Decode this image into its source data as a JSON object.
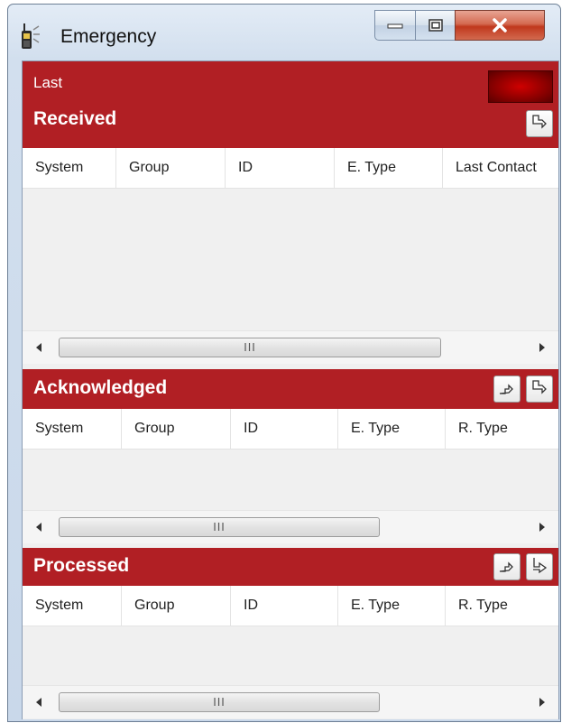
{
  "window": {
    "title": "Emergency"
  },
  "received": {
    "label_small": "Last",
    "label": "Received",
    "columns": [
      "System",
      "Group",
      "ID",
      "E. Type",
      "Last Contact"
    ],
    "scroll_grip": "III"
  },
  "acknowledged": {
    "label": "Acknowledged",
    "columns": [
      "System",
      "Group",
      "ID",
      "E. Type",
      "R. Type"
    ],
    "scroll_grip": "III"
  },
  "processed": {
    "label": "Processed",
    "columns": [
      "System",
      "Group",
      "ID",
      "E. Type",
      "R. Type"
    ],
    "scroll_grip": "III"
  },
  "colors": {
    "header": "#b11f24",
    "grid_bg": "#f0f0f0",
    "header_text": "#ffffff"
  }
}
